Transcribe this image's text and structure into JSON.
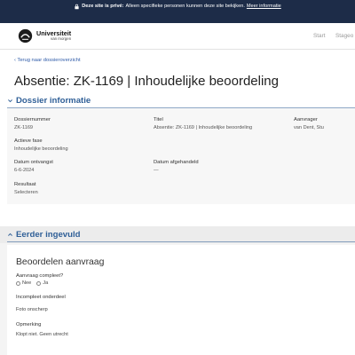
{
  "banner": {
    "bold": "Deze site is privé:",
    "text": "Alleen specifieke personen kunnen deze site bekijken.",
    "link": "Meer informatie"
  },
  "header": {
    "logo_name": "Universiteit",
    "logo_sub": "van morgen",
    "nav": [
      "Start",
      "Stageo"
    ]
  },
  "back_link": "‹ Terug naar dossieroverzicht",
  "page_title": "Absentie: ZK-1169 | Inhoudelijke beoordeling",
  "dossier": {
    "heading": "Dossier informatie",
    "fields": {
      "dossiernummer": {
        "label": "Dossiernummer",
        "value": "ZK-1169"
      },
      "titel": {
        "label": "Titel",
        "value": "Absentie: ZK-1169 | Inhoudelijke beoordeling"
      },
      "aanvrager": {
        "label": "Aanvrager",
        "value": "van Dent, Stu"
      },
      "fase": {
        "label": "Actieve fase",
        "value": "Inhoudelijke beoordeling"
      },
      "ontvangst": {
        "label": "Datum ontvangst",
        "value": "6-6-2024"
      },
      "afgehandeld": {
        "label": "Datum afgehandeld",
        "value": "—"
      },
      "resultaat": {
        "label": "Resultaat",
        "value": "Selecteren"
      }
    }
  },
  "eerder": {
    "heading": "Eerder ingevuld",
    "card_title": "Beoordelen aanvraag",
    "compleet": {
      "label": "Aanvraag compleet?",
      "options": [
        "Nee",
        "Ja"
      ]
    },
    "incompleet": {
      "label": "Incompleet onderdeel",
      "value": "Foto onscherp"
    },
    "opmerking": {
      "label": "Opmerking",
      "value": "Klopt niet. Geen utrecht"
    }
  },
  "colors": {
    "navy": "#1d2c48",
    "section_blue": "#2f5f97",
    "link_blue": "#2d5aa8"
  }
}
